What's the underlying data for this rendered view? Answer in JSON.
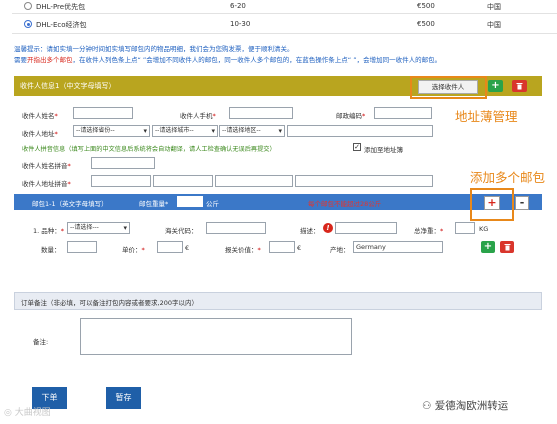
{
  "shipping_options": [
    {
      "name": "DHL-Pre优先包",
      "weight_range": "6-20",
      "price": "€500",
      "country": "中国",
      "selected": false
    },
    {
      "name": "DHL-Eco经济包",
      "weight_range": "10-30",
      "price": "€500",
      "country": "中国",
      "selected": true
    }
  ],
  "notice": {
    "line1": "温馨提示：请如实填一分钟时间如实填写邮包内的物品明细，我们会为您购发票，便于顺利清关。",
    "line2_prefix": "需要",
    "line2_highlight": "开指出多个邮包",
    "line2_rest": "，在收件人列色条上点“ ”会增加不同收件人的邮包，同一收件人多个邮包的，在蓝色操作条上点“ ”，会增加同一收件人的邮包。"
  },
  "recipient_section": {
    "header": "收件人信息1（中文字母填写）",
    "select_recipient_button": "选择收件人",
    "add_icon": "plus-icon",
    "delete_icon": "trash-icon",
    "name_label": "收件人姓名",
    "phone_label": "收件人手机",
    "zip_label": "邮政编码",
    "address_label": "收件人地址",
    "province_placeholder": "--请选择省份--",
    "city_placeholder": "--请选择城市--",
    "district_placeholder": "--请选择地区--",
    "pinyin_note": "收件人拼音信息（填写上面的中文信息后系统将会自动翻译，请人工检查确认无误后再提交）",
    "add_to_address_book": "添加至地址簿",
    "add_to_address_book_checked": true,
    "name_pinyin_label": "收件人姓名拼音",
    "address_pinyin_label": "收件人地址拼音"
  },
  "parcel_section": {
    "header": "邮包1-1（英文字母填写）",
    "weight_label": "邮包重量",
    "weight_unit": "公斤",
    "weight_warning": "每个邮包不能超过28公斤",
    "add_button": "+",
    "remove_button": "-",
    "item_index": "1. 品种：",
    "category_placeholder": "--请选择---",
    "customs_code_label": "海关代码",
    "description_label": "描述",
    "info_icon": "info-icon",
    "net_weight_label": "总净重",
    "net_weight_unit": "KG",
    "quantity_label": "数量",
    "unit_price_label": "单价",
    "currency_symbol": "€",
    "declared_value_label": "报关价值",
    "origin_label": "产地",
    "origin_value": "Germany"
  },
  "notes_section": {
    "header": "订单备注（非必填，可以备注打包内容或者要求,200字以内）",
    "label": "备注:"
  },
  "actions": {
    "submit": "下单",
    "save_draft": "暂存"
  },
  "annotations": {
    "address_book": "地址薄管理",
    "add_parcels": "添加多个邮包"
  },
  "watermarks": {
    "left": "大曲视图",
    "right": "爱德淘欧洲转运"
  },
  "colors": {
    "recipient_bar": "#b9a51f",
    "parcel_bar": "#3b78c8",
    "notice_text": "#1d5fbf",
    "highlight_red": "#d8261b",
    "annotation_orange": "#e8881a",
    "button_blue": "#1f5fa8"
  }
}
